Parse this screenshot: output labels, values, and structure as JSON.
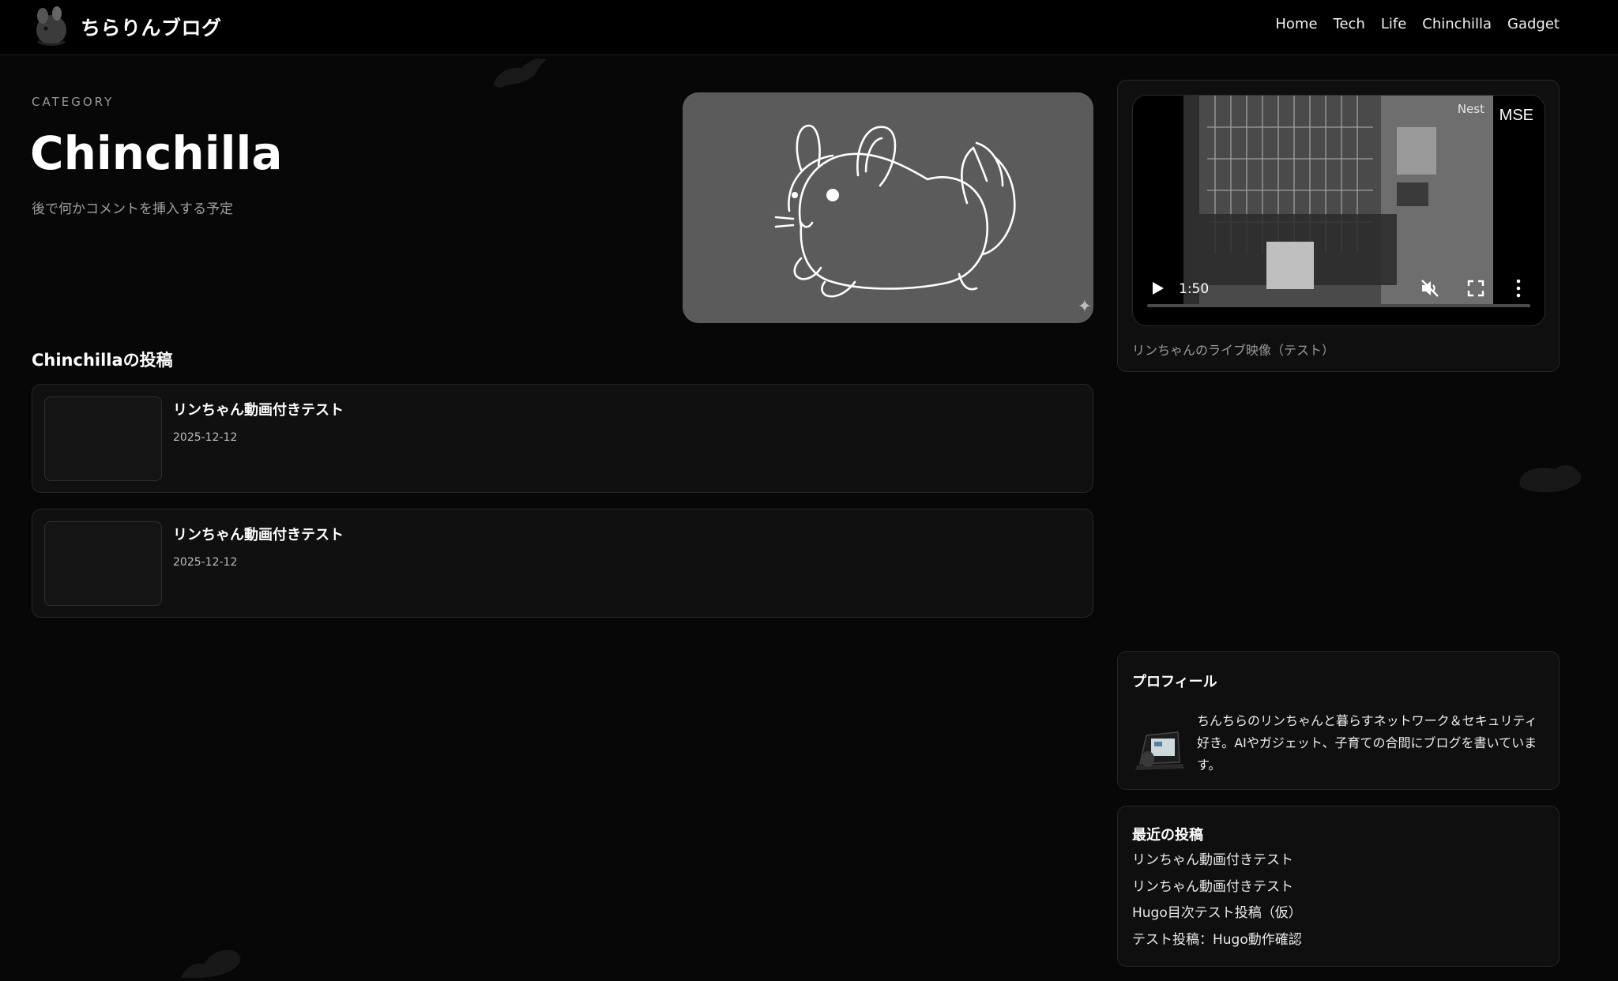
{
  "site": {
    "title": "ちらりんブログ"
  },
  "nav": {
    "items": [
      {
        "label": "Home"
      },
      {
        "label": "Tech"
      },
      {
        "label": "Life"
      },
      {
        "label": "Chinchilla"
      },
      {
        "label": "Gadget"
      }
    ]
  },
  "category": {
    "label": "CATEGORY",
    "title": "Chinchilla",
    "description": "後で何かコメントを挿入する予定"
  },
  "posts": {
    "heading": "Chinchillaの投稿",
    "items": [
      {
        "title": "リンちゃん動画付きテスト",
        "date": "2025-12-12"
      },
      {
        "title": "リンちゃん動画付きテスト",
        "date": "2025-12-12"
      }
    ]
  },
  "video": {
    "overlay_brand": "Nest",
    "overlay_tag": "MSE",
    "time": "1:50",
    "caption": "リンちゃんのライブ映像（テスト）"
  },
  "profile": {
    "heading": "プロフィール",
    "text": "ちんちらのリンちゃんと暮らすネットワーク＆セキュリティ好き。AIやガジェット、子育ての合間にブログを書いています。"
  },
  "recent": {
    "heading": "最近の投稿",
    "items": [
      {
        "label": "リンちゃん動画付きテスト"
      },
      {
        "label": "リンちゃん動画付きテスト"
      },
      {
        "label": "Hugo目次テスト投稿（仮）"
      },
      {
        "label": "テスト投稿：Hugo動作確認"
      }
    ]
  },
  "colors": {
    "background": "#070707",
    "header": "#000000",
    "card": "#101010",
    "hero": "#5b5b5b"
  },
  "icons": {
    "play": "play-icon",
    "mute": "volume-mute-icon",
    "fullscreen": "fullscreen-icon",
    "more": "more-vertical-icon"
  }
}
